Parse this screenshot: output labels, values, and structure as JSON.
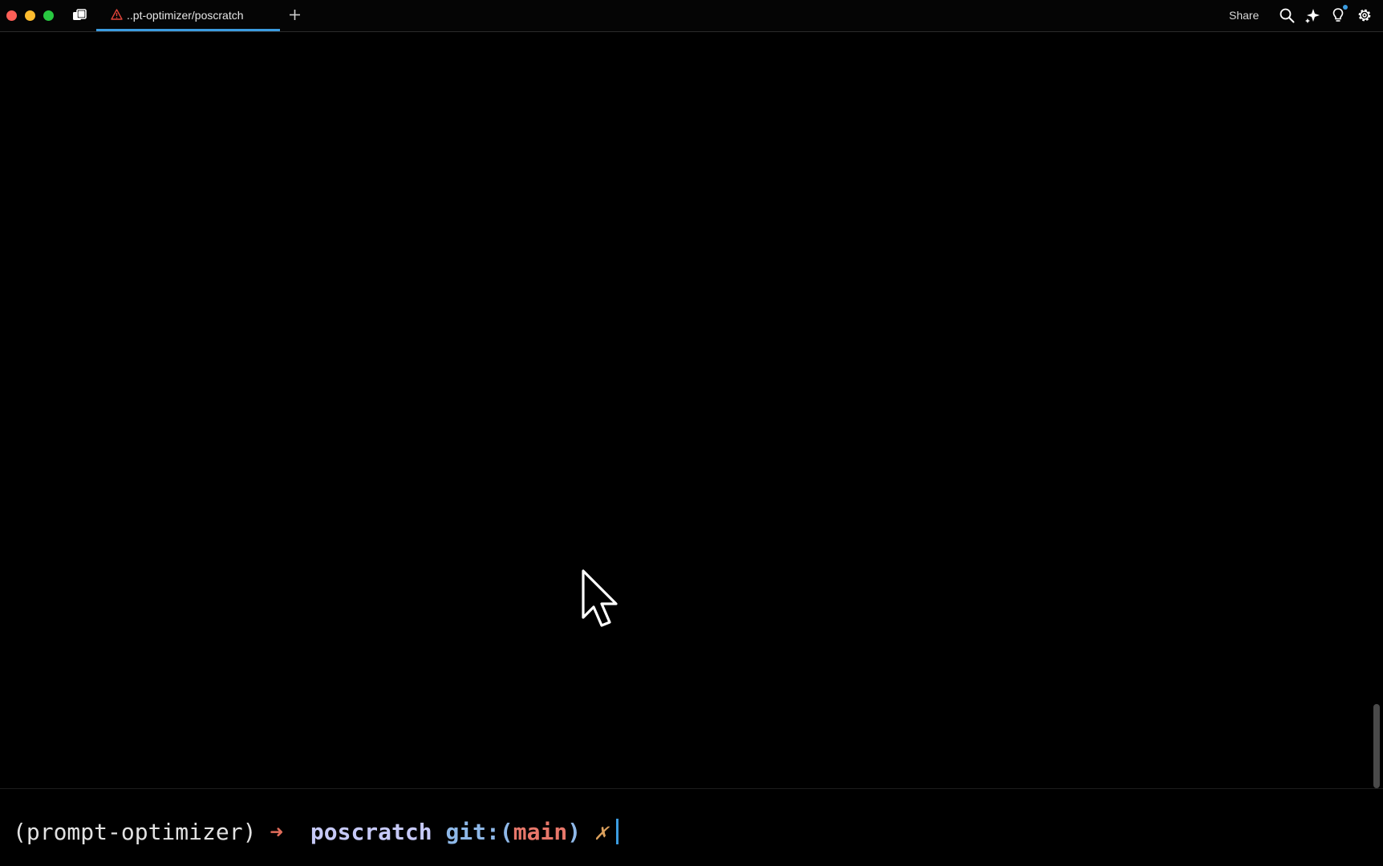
{
  "window": {
    "traffic_lights": {
      "close_color": "#fe5f57",
      "minimize_color": "#febc2e",
      "maximize_color": "#28c840"
    }
  },
  "titlebar": {
    "tabs": [
      {
        "title": "..pt-optimizer/poscratch",
        "icon": "warning-triangle-icon",
        "active": true
      }
    ],
    "new_tab_icon": "plus-icon",
    "share_label": "Share",
    "right_icons": [
      "search-icon",
      "sparkle-icon",
      "lightbulb-icon",
      "gear-icon"
    ]
  },
  "terminal": {
    "prompt": {
      "env": "(prompt-optimizer)",
      "arrow": "➜",
      "directory": "poscratch",
      "git_prefix": "git:(",
      "branch": "main",
      "git_suffix": ")",
      "dirty_marker": "✗"
    }
  },
  "colors": {
    "accent": "#3b9ce0",
    "background": "#000000",
    "arrow": "#e06c5a",
    "directory": "#c6c9f7",
    "git": "#8eb8e8",
    "branch": "#e7776a",
    "dirty": "#dca15d"
  }
}
